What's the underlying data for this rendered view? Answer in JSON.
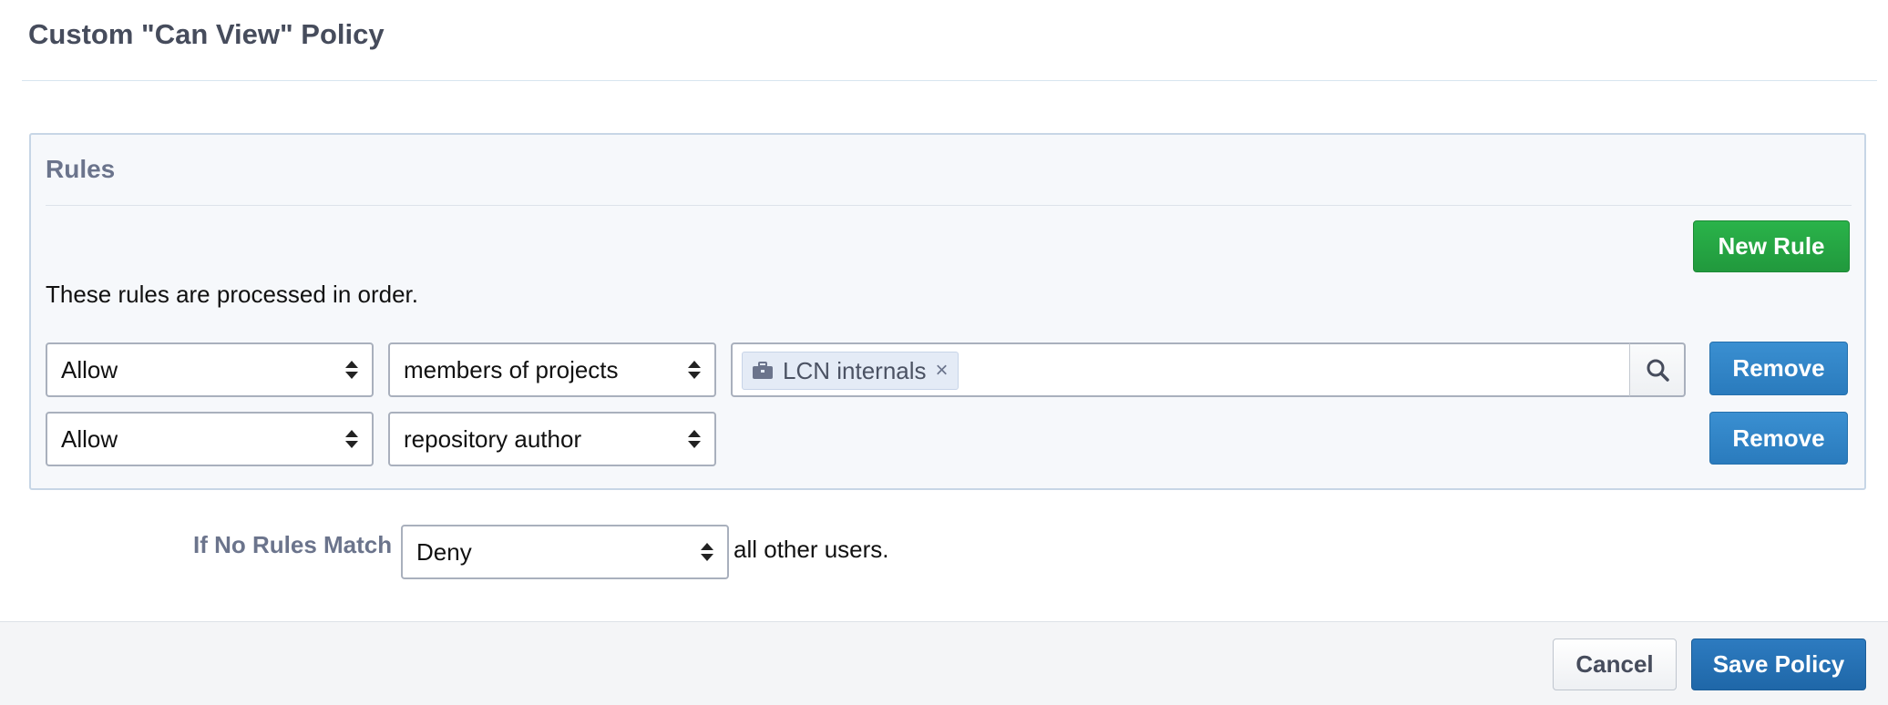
{
  "dialog": {
    "title": "Custom \"Can View\" Policy"
  },
  "rules": {
    "title": "Rules",
    "description": "These rules are processed in order.",
    "new_rule_label": "New Rule",
    "items": [
      {
        "action": "Allow",
        "target": "members of projects",
        "tokens": [
          "LCN internals"
        ],
        "token_icon": "briefcase-icon",
        "remove_label": "Remove"
      },
      {
        "action": "Allow",
        "target": "repository author",
        "remove_label": "Remove"
      }
    ]
  },
  "fallback": {
    "label": "If No Rules Match",
    "value": "Deny",
    "suffix": "all other users."
  },
  "footer": {
    "cancel_label": "Cancel",
    "save_label": "Save Policy"
  },
  "colors": {
    "green": "#21993d",
    "blue": "#2a7bbd",
    "token_bg": "#e4ebf6"
  }
}
